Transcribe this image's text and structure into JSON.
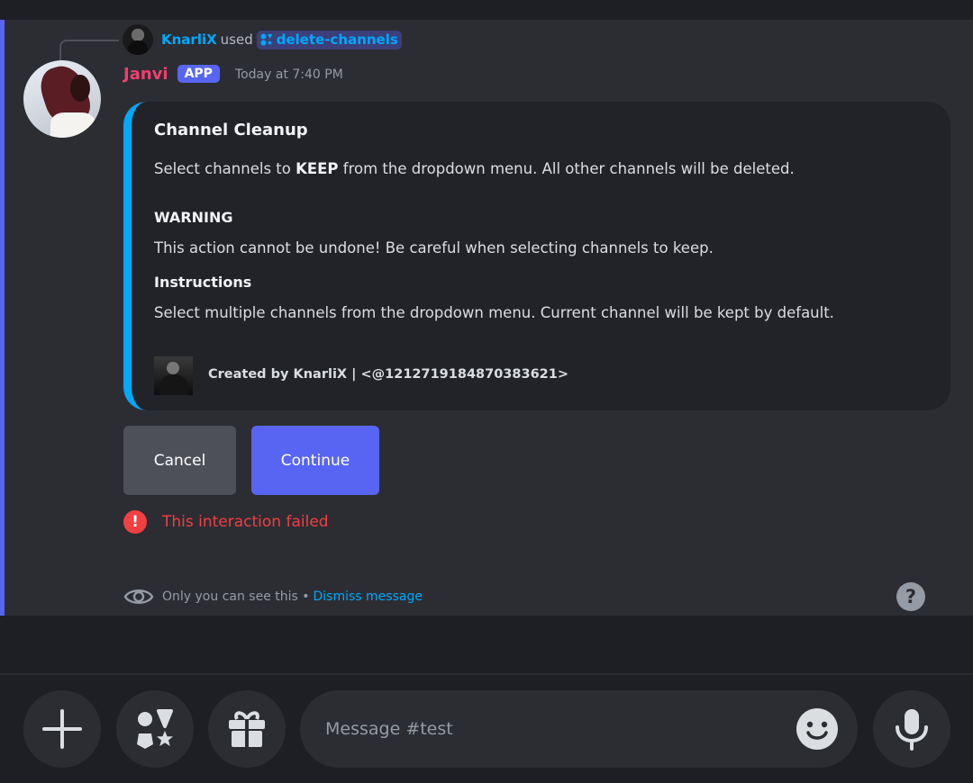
{
  "reply": {
    "user": "KnarliX",
    "used_text": "used",
    "command": "delete-channels"
  },
  "message": {
    "author": "Janvi",
    "badge": "APP",
    "timestamp": "Today at 7:40 PM"
  },
  "embed": {
    "title": "Channel Cleanup",
    "desc_prefix": "Select channels to",
    "desc_bold": "KEEP",
    "desc_suffix": "from the dropdown menu. All other channels will be deleted.",
    "fields": [
      {
        "name": "WARNING",
        "value": "This action cannot be undone! Be careful when selecting channels to keep."
      },
      {
        "name": "Instructions",
        "value": "Select multiple channels from the dropdown menu. Current channel will be kept by default."
      }
    ],
    "footer": "Created by KnarliX | <@1212719184870383621>"
  },
  "buttons": {
    "cancel": "Cancel",
    "continue": "Continue"
  },
  "error": {
    "text": "This interaction failed"
  },
  "ephemeral": {
    "text": "Only you can see this •",
    "link": "Dismiss message"
  },
  "composer": {
    "placeholder": "Message #test"
  },
  "colors": {
    "accent": "#5865f2",
    "link": "#00a8fc",
    "username": "#f23f6f",
    "error": "#f23f42"
  }
}
